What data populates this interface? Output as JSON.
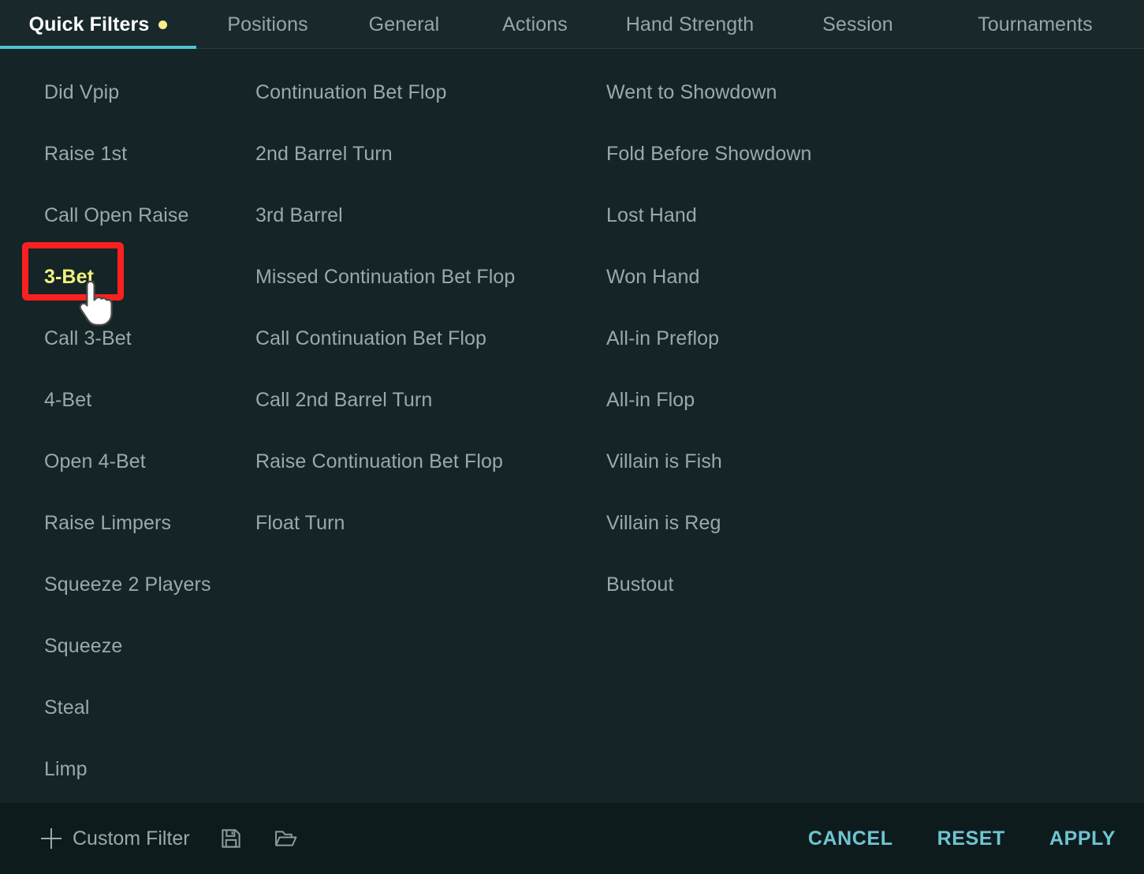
{
  "tabs": [
    {
      "label": "Quick Filters",
      "active": true,
      "has_dot": true
    },
    {
      "label": "Positions",
      "active": false,
      "has_dot": false
    },
    {
      "label": "General",
      "active": false,
      "has_dot": false
    },
    {
      "label": "Actions",
      "active": false,
      "has_dot": false
    },
    {
      "label": "Hand Strength",
      "active": false,
      "has_dot": false
    },
    {
      "label": "Session",
      "active": false,
      "has_dot": false
    },
    {
      "label": "Tournaments",
      "active": false,
      "has_dot": false
    }
  ],
  "columns": {
    "col1": [
      "Did Vpip",
      "Raise 1st",
      "Call Open Raise",
      "3-Bet",
      "Call 3-Bet",
      "4-Bet",
      "Open 4-Bet",
      "Raise Limpers",
      "Squeeze 2 Players",
      "Squeeze",
      "Steal",
      "Limp"
    ],
    "col2": [
      "Continuation Bet Flop",
      "2nd Barrel Turn",
      "3rd Barrel",
      "Missed Continuation Bet Flop",
      "Call Continuation Bet Flop",
      "Call 2nd Barrel Turn",
      "Raise Continuation Bet Flop",
      "Float Turn"
    ],
    "col3": [
      "Went to Showdown",
      "Fold Before Showdown",
      "Lost Hand",
      "Won Hand",
      "All-in Preflop",
      "All-in Flop",
      "Villain is Fish",
      "Villain is Reg",
      "Bustout"
    ]
  },
  "highlighted_item": "3-Bet",
  "footer": {
    "custom_filter_label": "Custom Filter",
    "save_icon": "floppy-disk-save-icon",
    "open_icon": "open-folder-icon",
    "cancel_label": "CANCEL",
    "reset_label": "RESET",
    "apply_label": "APPLY"
  },
  "colors": {
    "accent_cyan": "#4fc3cf",
    "action_text": "#6ec5d1",
    "highlight_yellow": "#f2f07c",
    "tab_dot_yellow": "#f4ef8a",
    "annotation_red": "#fb2020",
    "item_text": "#9aa9a9",
    "tab_bg": "#18282b",
    "content_bg": "#152427",
    "footer_bg": "#0e1b1d"
  },
  "annotation": {
    "target": "3-Bet",
    "cursor": "pointing-hand-cursor"
  }
}
